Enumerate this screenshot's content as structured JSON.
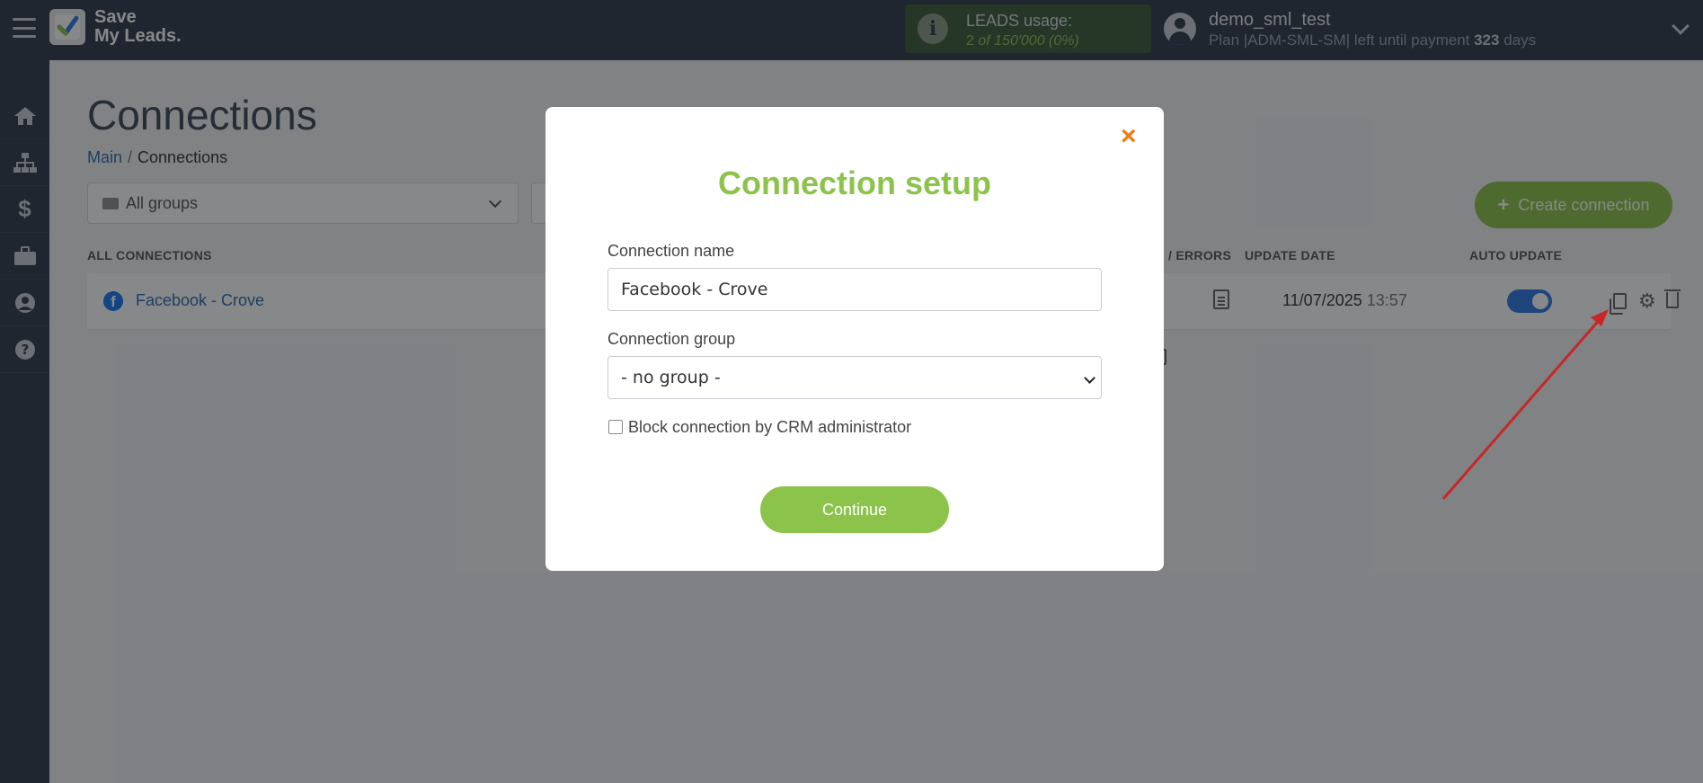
{
  "header": {
    "logo_text": "Save\nMy Leads.",
    "usage_title": "LEADS usage:",
    "usage_value_num": "2",
    "usage_value_rest": " of 150'000 (0%)",
    "user_name": "demo_sml_test",
    "user_plan": "Plan |ADM-SML-SM| left until payment ",
    "user_days": "323",
    "user_days_suffix": " days"
  },
  "sidebar": {
    "items": [
      {
        "icon": "home-icon"
      },
      {
        "icon": "sitemap-icon"
      },
      {
        "icon": "dollar-icon"
      },
      {
        "icon": "briefcase-icon"
      },
      {
        "icon": "user-icon"
      },
      {
        "icon": "help-icon"
      }
    ]
  },
  "page": {
    "title": "Connections",
    "breadcrumb_main": "Main",
    "breadcrumb_sep": "/",
    "breadcrumb_current": "Connections",
    "groups_select": "All groups",
    "create_button": "Create connection"
  },
  "table": {
    "col_all": "ALL CONNECTIONS",
    "col_errors": "/ ERRORS",
    "col_update_date": "UPDATE DATE",
    "col_auto_update": "AUTO UPDATE",
    "rows": [
      {
        "name": "Facebook - Crove",
        "date": "11/07/2025",
        "time": "13:57",
        "auto_update": true
      }
    ]
  },
  "modal": {
    "title": "Connection setup",
    "name_label": "Connection name",
    "name_value": "Facebook - Crove",
    "group_label": "Connection group",
    "group_value": "- no group -",
    "block_label": "Block connection by CRM administrator",
    "block_checked": false,
    "continue_button": "Continue",
    "close": "×"
  },
  "colors": {
    "accent_green": "#8cc34a",
    "close_orange": "#f07b14",
    "topbar": "#2f3a4b",
    "link_blue": "#2d6bb3",
    "annotation_arrow": "#c62828"
  }
}
